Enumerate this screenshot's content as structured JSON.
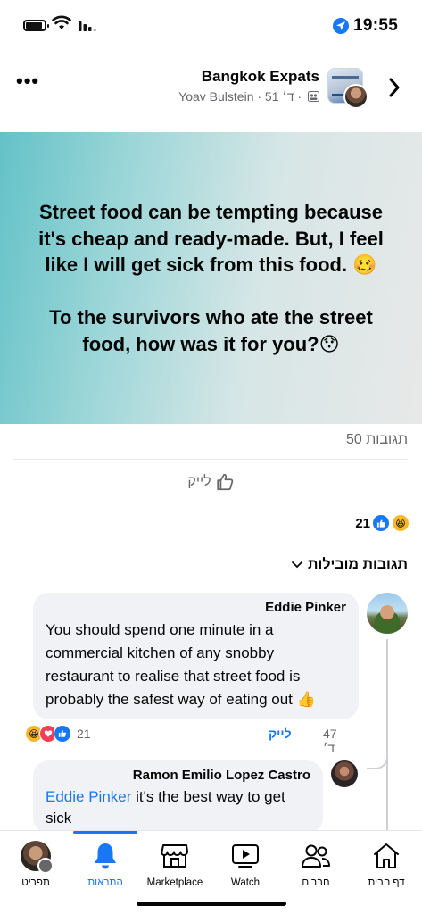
{
  "status_bar": {
    "time": "19:55"
  },
  "header": {
    "group_name": "Bangkok Expats",
    "meta": "Yoav Bulstein · 51 ד׳ ·"
  },
  "post": {
    "text": "Street food can be tempting because it's cheap and ready-made. But, I feel like I will get sick from this food. 🥴\n\nTo the survivors who ate the street food, how was it for you?😯",
    "comments_count": "50 תגובות",
    "like_label": "לייק",
    "reactions_count": "21",
    "comments_filter": "תגובות מובילות"
  },
  "comments": [
    {
      "author": "Eddie Pinker",
      "text": "You should spend one minute in a commercial kitchen of any snobby restaurant to realise that street food is probably the safest way of eating out 👍",
      "like_label": "לייק",
      "time": "47 ד׳",
      "reactions_count": "21"
    },
    {
      "author": "Ramon Emilio Lopez Castro",
      "mention": "Eddie Pinker",
      "text": " it's the best way to get sick"
    }
  ],
  "nav": {
    "items": [
      {
        "label": "תפריט",
        "icon": "profile-avatar-icon"
      },
      {
        "label": "התראות",
        "icon": "bell-icon",
        "active": true
      },
      {
        "label": "Marketplace",
        "icon": "shop-icon"
      },
      {
        "label": "Watch",
        "icon": "video-icon"
      },
      {
        "label": "חברים",
        "icon": "friends-icon"
      },
      {
        "label": "דף הבית",
        "icon": "home-icon"
      }
    ]
  },
  "colors": {
    "accent": "#1877f2",
    "muted": "#65676b",
    "bubble": "#f0f2f5"
  }
}
